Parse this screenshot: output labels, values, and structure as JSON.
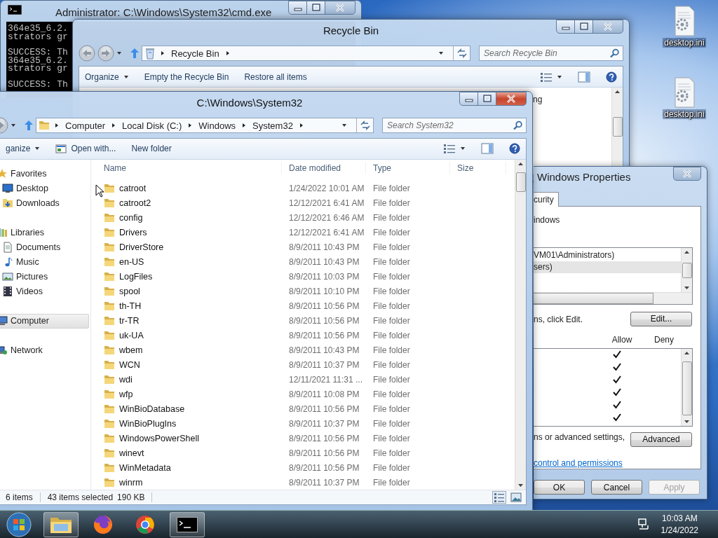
{
  "cmd_window": {
    "title": "Administrator: C:\\Windows\\System32\\cmd.exe",
    "blocks": [
      [
        "364e35_6.2.",
        "strators gr"
      ],
      [
        "SUCCESS: Th",
        "364e35_6.2.",
        "strators gr"
      ],
      [
        "SUCCESS: Th"
      ]
    ]
  },
  "recycle_window": {
    "title": "Recycle Bin",
    "address": [
      "Recycle Bin"
    ],
    "search": {
      "placeholder": "Search Recycle Bin"
    },
    "toolbar": [
      {
        "label": "Organize",
        "kind": "menu"
      },
      {
        "label": "Empty the Recycle Bin",
        "kind": "plain"
      },
      {
        "label": "Restore all items",
        "kind": "plain"
      }
    ],
    "content_fragment": "ng"
  },
  "properties_window": {
    "title": "Windows Properties",
    "tab": {
      "label": "curity",
      "selected": true
    },
    "object_name": "indows",
    "principals": [
      {
        "text": "VM01\\Administrators)",
        "selected": false
      },
      {
        "text": "sers)",
        "selected": true
      }
    ],
    "edit_hint": "ns, click Edit.",
    "edit_button": "Edit...",
    "columns": [
      "Allow",
      "Deny"
    ],
    "permissions": [
      {
        "allow": true,
        "deny": false
      },
      {
        "allow": true,
        "deny": false
      },
      {
        "allow": true,
        "deny": false
      },
      {
        "allow": true,
        "deny": false
      },
      {
        "allow": true,
        "deny": false
      },
      {
        "allow": true,
        "deny": false
      }
    ],
    "advanced_hint": "ns or advanced settings,",
    "advanced_button": "Advanced",
    "link": "control and permissions",
    "buttons": [
      {
        "label": "OK",
        "disabled": false
      },
      {
        "label": "Cancel",
        "disabled": false
      },
      {
        "label": "Apply",
        "disabled": true
      }
    ]
  },
  "explorer_window": {
    "title": "C:\\Windows\\System32",
    "address": [
      "Computer",
      "Local Disk (C:)",
      "Windows",
      "System32"
    ],
    "search": {
      "placeholder": "Search System32"
    },
    "toolbar": [
      {
        "label": "ganize",
        "kind": "menu"
      },
      {
        "label": "Open with...",
        "kind": "icon"
      },
      {
        "label": "New folder",
        "kind": "plain"
      }
    ],
    "nav": [
      {
        "label": "Favorites",
        "kind": "favorites",
        "selected": false,
        "children": [
          {
            "label": "Desktop",
            "kind": "desktop",
            "selected": false
          },
          {
            "label": "Downloads",
            "kind": "downloads",
            "selected": false
          }
        ]
      },
      {
        "label": "Libraries",
        "kind": "libraries",
        "selected": false,
        "children": [
          {
            "label": "Documents",
            "kind": "documents",
            "selected": false
          },
          {
            "label": "Music",
            "kind": "music",
            "selected": false
          },
          {
            "label": "Pictures",
            "kind": "pictures",
            "selected": false
          },
          {
            "label": "Videos",
            "kind": "videos",
            "selected": false
          }
        ]
      },
      {
        "label": "Computer",
        "kind": "computer",
        "selected": true
      },
      {
        "label": "Network",
        "kind": "network",
        "selected": false
      }
    ],
    "columns": [
      "Name",
      "Date modified",
      "Type",
      "Size"
    ],
    "rows": [
      {
        "name": "catroot",
        "date": "1/24/2022 10:01 AM",
        "type": "File folder"
      },
      {
        "name": "catroot2",
        "date": "12/12/2021 6:41 AM",
        "type": "File folder"
      },
      {
        "name": "config",
        "date": "12/12/2021 6:46 AM",
        "type": "File folder"
      },
      {
        "name": "Drivers",
        "date": "12/12/2021 6:41 AM",
        "type": "File folder"
      },
      {
        "name": "DriverStore",
        "date": "8/9/2011 10:43 PM",
        "type": "File folder"
      },
      {
        "name": "en-US",
        "date": "8/9/2011 10:43 PM",
        "type": "File folder"
      },
      {
        "name": "LogFiles",
        "date": "8/9/2011 10:03 PM",
        "type": "File folder"
      },
      {
        "name": "spool",
        "date": "8/9/2011 10:10 PM",
        "type": "File folder"
      },
      {
        "name": "th-TH",
        "date": "8/9/2011 10:56 PM",
        "type": "File folder"
      },
      {
        "name": "tr-TR",
        "date": "8/9/2011 10:56 PM",
        "type": "File folder"
      },
      {
        "name": "uk-UA",
        "date": "8/9/2011 10:56 PM",
        "type": "File folder"
      },
      {
        "name": "wbem",
        "date": "8/9/2011 10:43 PM",
        "type": "File folder"
      },
      {
        "name": "WCN",
        "date": "8/9/2011 10:37 PM",
        "type": "File folder"
      },
      {
        "name": "wdi",
        "date": "12/11/2021 11:31 ...",
        "type": "File folder"
      },
      {
        "name": "wfp",
        "date": "8/9/2011 10:08 PM",
        "type": "File folder"
      },
      {
        "name": "WinBioDatabase",
        "date": "8/9/2011 10:56 PM",
        "type": "File folder"
      },
      {
        "name": "WinBioPlugIns",
        "date": "8/9/2011 10:37 PM",
        "type": "File folder"
      },
      {
        "name": "WindowsPowerShell",
        "date": "8/9/2011 10:56 PM",
        "type": "File folder"
      },
      {
        "name": "winevt",
        "date": "8/9/2011 10:56 PM",
        "type": "File folder"
      },
      {
        "name": "WinMetadata",
        "date": "8/9/2011 10:56 PM",
        "type": "File folder"
      },
      {
        "name": "winrm",
        "date": "8/9/2011 10:37 PM",
        "type": "File folder"
      }
    ],
    "status": {
      "count": "6 items",
      "selection": "43 items selected",
      "size": "190 KB"
    }
  },
  "desktop_icons": [
    {
      "label": "desktop.ini"
    },
    {
      "label": "desktop.ini"
    }
  ],
  "taskbar": {
    "apps": [
      {
        "kind": "explorer",
        "active": true
      },
      {
        "kind": "firefox",
        "active": false
      },
      {
        "kind": "chrome",
        "active": false
      },
      {
        "kind": "cmd",
        "active": true
      }
    ],
    "time": "10:03 AM",
    "date": "1/24/2022"
  }
}
